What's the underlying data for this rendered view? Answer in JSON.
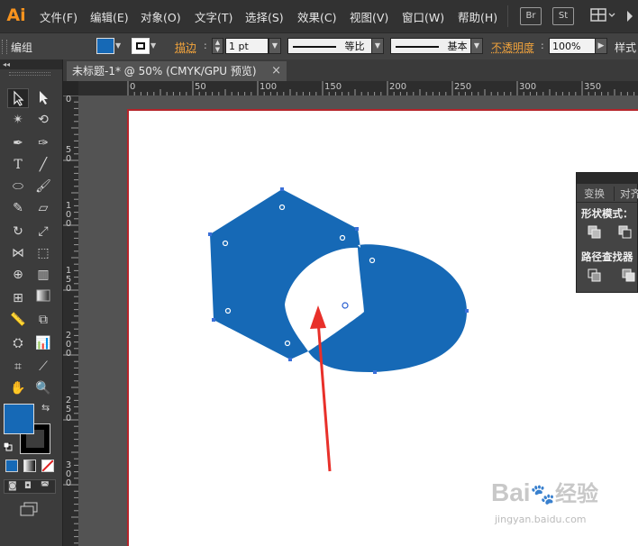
{
  "app": {
    "logo": "Ai"
  },
  "menu": {
    "items": [
      "文件(F)",
      "编辑(E)",
      "对象(O)",
      "文字(T)",
      "选择(S)",
      "效果(C)",
      "视图(V)",
      "窗口(W)",
      "帮助(H)"
    ],
    "bridge_label": "Br",
    "stock_label": "St"
  },
  "control_bar": {
    "selection_label": "编组",
    "stroke_label": "描边",
    "stroke_weight": "1 pt",
    "profile_label": "等比",
    "brush_label": "基本",
    "opacity_label": "不透明度",
    "opacity_value": "100%",
    "style_label": "样式"
  },
  "document": {
    "tab_title": "未标题-1* @ 50% (CMYK/GPU 预览)",
    "close_glyph": "×"
  },
  "rulers": {
    "top_labels": [
      "0",
      "50",
      "100",
      "150",
      "200",
      "250",
      "300",
      "350"
    ],
    "left_labels": [
      "0",
      "50",
      "100",
      "150",
      "200",
      "250",
      "300"
    ]
  },
  "panel": {
    "tabs": [
      "变换",
      "对齐"
    ],
    "shape_modes_label": "形状模式：",
    "pathfinder_label": "路径查找器"
  },
  "colors": {
    "fill": "#1669b6",
    "arrow": "#e8302a",
    "artboard_border": "#b5242a",
    "logo": "#f7931e"
  },
  "watermark": {
    "brand": "Bai",
    "brand_tail": "经验",
    "url": "jingyan.baidu.com"
  }
}
